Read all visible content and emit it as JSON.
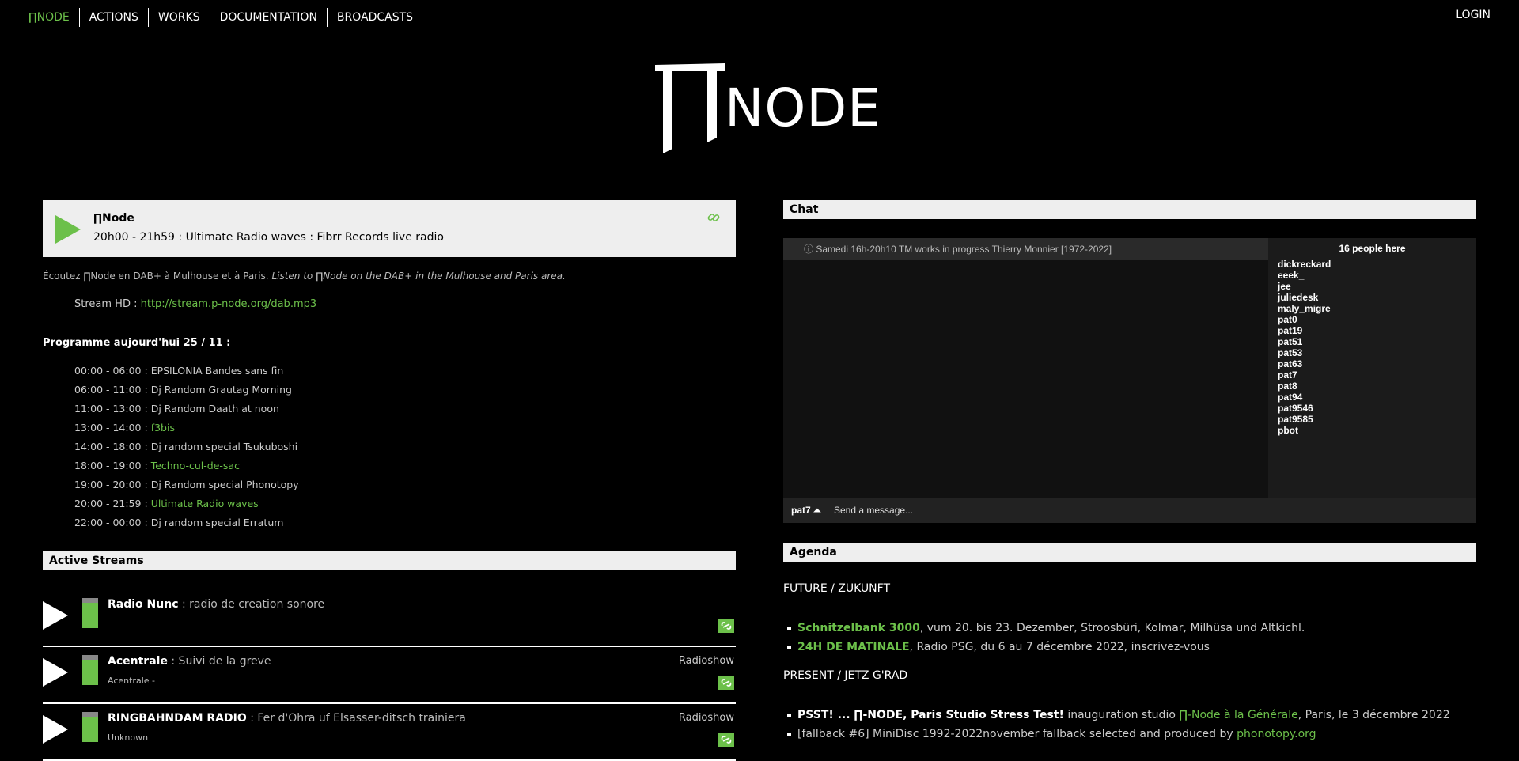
{
  "nav": {
    "items": [
      "∏NODE",
      "ACTIONS",
      "WORKS",
      "DOCUMENTATION",
      "BROADCASTS"
    ],
    "login": "LOGIN"
  },
  "logo": {
    "symbol": "∏",
    "text": "NODE"
  },
  "player": {
    "name": "∏Node",
    "show": "20h00 - 21h59 :  Ultimate Radio waves : Fibrr Records live radio",
    "link_icon": "link-icon"
  },
  "listen": {
    "fr": "Écoutez ∏Node en DAB+ à Mulhouse et à Paris.",
    "en": "Listen to ∏Node on the DAB+ in the Mulhouse and Paris area."
  },
  "stream_hd": {
    "label": "Stream HD :",
    "url": "http://stream.p-node.org/dab.mp3"
  },
  "programme": {
    "title": "Programme aujourd'hui 25 / 11 :",
    "items": [
      {
        "time": "00:00 - 06:00 :",
        "show": "EPSILONIA Bandes sans fin",
        "link": false
      },
      {
        "time": "06:00 - 11:00 :",
        "show": "Dj Random Grautag Morning",
        "link": false
      },
      {
        "time": "11:00 - 13:00 :",
        "show": "Dj Random Daath at noon",
        "link": false
      },
      {
        "time": "13:00 - 14:00 :",
        "show": "f3bis",
        "link": true
      },
      {
        "time": "14:00 - 18:00 :",
        "show": "Dj random special Tsukuboshi",
        "link": false
      },
      {
        "time": "18:00 - 19:00 :",
        "show": "Techno-cul-de-sac",
        "link": true
      },
      {
        "time": "19:00 - 20:00 :",
        "show": "Dj Random special Phonotopy",
        "link": false
      },
      {
        "time": "20:00 - 21:59 :",
        "show": "Ultimate Radio waves",
        "link": true
      },
      {
        "time": "22:00 - 00:00 :",
        "show": "Dj random special Erratum",
        "link": false
      }
    ]
  },
  "active_streams": {
    "title": "Active Streams",
    "items": [
      {
        "name": "Radio Nunc",
        "desc": " : radio de creation sonore",
        "sub": "",
        "type": ""
      },
      {
        "name": "Acentrale",
        "desc": " : Suivi de la greve",
        "sub": "Acentrale -",
        "type": "Radioshow"
      },
      {
        "name": "RINGBAHNDAM RADIO",
        "desc": " : Fer d'Ohra uf Elsasser-ditsch trainiera",
        "sub": "Unknown",
        "type": "Radioshow"
      }
    ]
  },
  "chat": {
    "title": "Chat",
    "topic": "ⓘ Samedi 16h-20h10 TM works in progress Thierry Monnier [1972-2022]",
    "people_count": "16 people here",
    "users": [
      "dickreckard",
      "eeek_",
      "jee",
      "juliedesk",
      "maly_migre",
      "pat0",
      "pat19",
      "pat51",
      "pat53",
      "pat63",
      "pat7",
      "pat8",
      "pat94",
      "pat9546",
      "pat9585",
      "pbot"
    ],
    "nick": "pat7 ⏶",
    "input_placeholder": "Send a message..."
  },
  "agenda": {
    "title": "Agenda",
    "future_title": "FUTURE / ZUKUNFT",
    "future": [
      {
        "bold": "Schnitzelbank 3000",
        "rest": ", vum 20. bis 23. Dezember, Stroosbüri, Kolmar, Milhüsa und Altkichl."
      },
      {
        "bold": "24H DE MATINALE",
        "rest": ", Radio PSG, du 6 au 7 décembre 2022, inscrivez-vous"
      }
    ],
    "present_title": "PRESENT / JETZ G'RAD",
    "present": [
      {
        "bold": "PSST! ... ∏-NODE, Paris Studio Stress Test!",
        "mid": " inauguration studio ",
        "link": "∏-Node à la Générale",
        "rest": ", Paris, le 3 décembre 2022"
      },
      {
        "bold": "",
        "mid": "[fallback #6] MiniDisc 1992-2022november fallback selected and produced by ",
        "link": "phonotopy.org",
        "rest": ""
      }
    ]
  },
  "colors": {
    "accent": "#6cc04a",
    "bar": "#eeeeee",
    "background": "#000000"
  }
}
